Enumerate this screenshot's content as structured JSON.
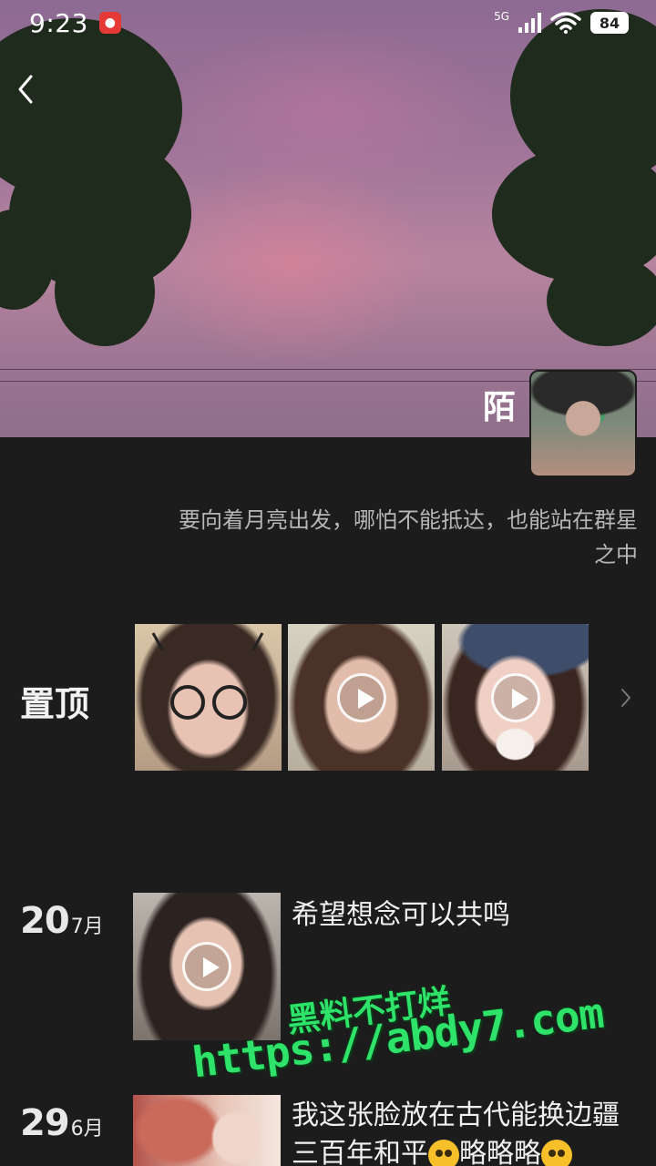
{
  "status_bar": {
    "time": "9:23",
    "network": "5G",
    "battery": "84"
  },
  "profile": {
    "name": "陌",
    "bio": "要向着月亮出发，哪怕不能抵达，也能站在群星之中"
  },
  "pinned": {
    "label": "置顶",
    "items": [
      {
        "type": "photo"
      },
      {
        "type": "video"
      },
      {
        "type": "video"
      }
    ]
  },
  "posts": [
    {
      "day": "20",
      "month": "7月",
      "text": "希望想念可以共鸣",
      "type": "video"
    },
    {
      "day": "29",
      "month": "6月",
      "text_line1": "我这张脸放在古代能换边疆",
      "text_line2_a": "三百年和平",
      "text_line2_b": "略略略",
      "type": "photo"
    }
  ],
  "watermark": {
    "line1": "黑料不打烊",
    "line2": "https://abdy7.com"
  },
  "colors": {
    "background": "#1c1c1c",
    "watermark": "#2fe36a"
  }
}
